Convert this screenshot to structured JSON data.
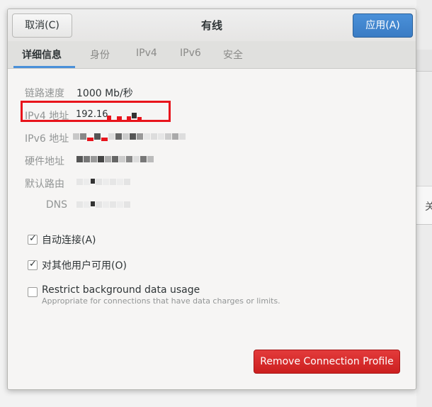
{
  "header": {
    "cancel_label": "取消(C)",
    "title": "有线",
    "apply_label": "应用(A)"
  },
  "tabs": [
    {
      "label": "详细信息",
      "active": true
    },
    {
      "label": "身份",
      "active": false
    },
    {
      "label": "IPv4",
      "active": false
    },
    {
      "label": "IPv6",
      "active": false
    },
    {
      "label": "安全",
      "active": false
    }
  ],
  "details": {
    "link_speed_label": "链路速度",
    "link_speed_value": "1000 Mb/秒",
    "ipv4_label": "IPv4 地址",
    "ipv4_value_visible": "192.16",
    "ipv6_label": "IPv6 地址",
    "hw_label": "硬件地址",
    "route_label": "默认路由",
    "dns_label": "DNS"
  },
  "options": {
    "auto_connect_label": "自动连接(A)",
    "auto_connect_checked": true,
    "all_users_label": "对其他用户可用(O)",
    "all_users_checked": true,
    "restrict_label": "Restrict background data usage",
    "restrict_checked": false,
    "restrict_sub": "Appropriate for connections that have data charges or limits."
  },
  "remove_label": "Remove Connection Profile",
  "background": {
    "fragment": "关"
  },
  "colors": {
    "accent": "#4a90d9",
    "destructive": "#cc1f1f",
    "annotation": "#e8141c"
  }
}
